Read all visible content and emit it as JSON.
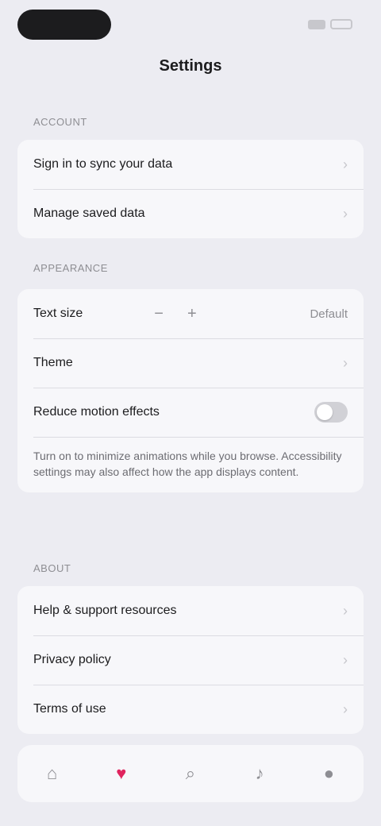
{
  "window": {
    "title": "Settings"
  },
  "sections": {
    "account": {
      "header": "Account",
      "rows": [
        {
          "label": "Sign in to sync your data"
        },
        {
          "label": "Manage saved data"
        }
      ]
    },
    "appearance": {
      "header": "Appearance",
      "text_size_label": "Text size",
      "text_size_value": "Default",
      "theme_label": "Theme",
      "reduce_motion_label": "Reduce motion effects",
      "note": "Turn on to minimize animations while you browse. Accessibility settings may also affect how the app displays content."
    },
    "about": {
      "header": "About",
      "rows": [
        {
          "label": "Help & support resources"
        },
        {
          "label": "Privacy policy"
        },
        {
          "label": "Terms of use"
        }
      ]
    }
  },
  "tabs": [
    {
      "icon": "home-icon"
    },
    {
      "icon": "heart-icon"
    },
    {
      "icon": "search-icon"
    },
    {
      "icon": "bell-icon"
    },
    {
      "icon": "profile-icon"
    }
  ]
}
